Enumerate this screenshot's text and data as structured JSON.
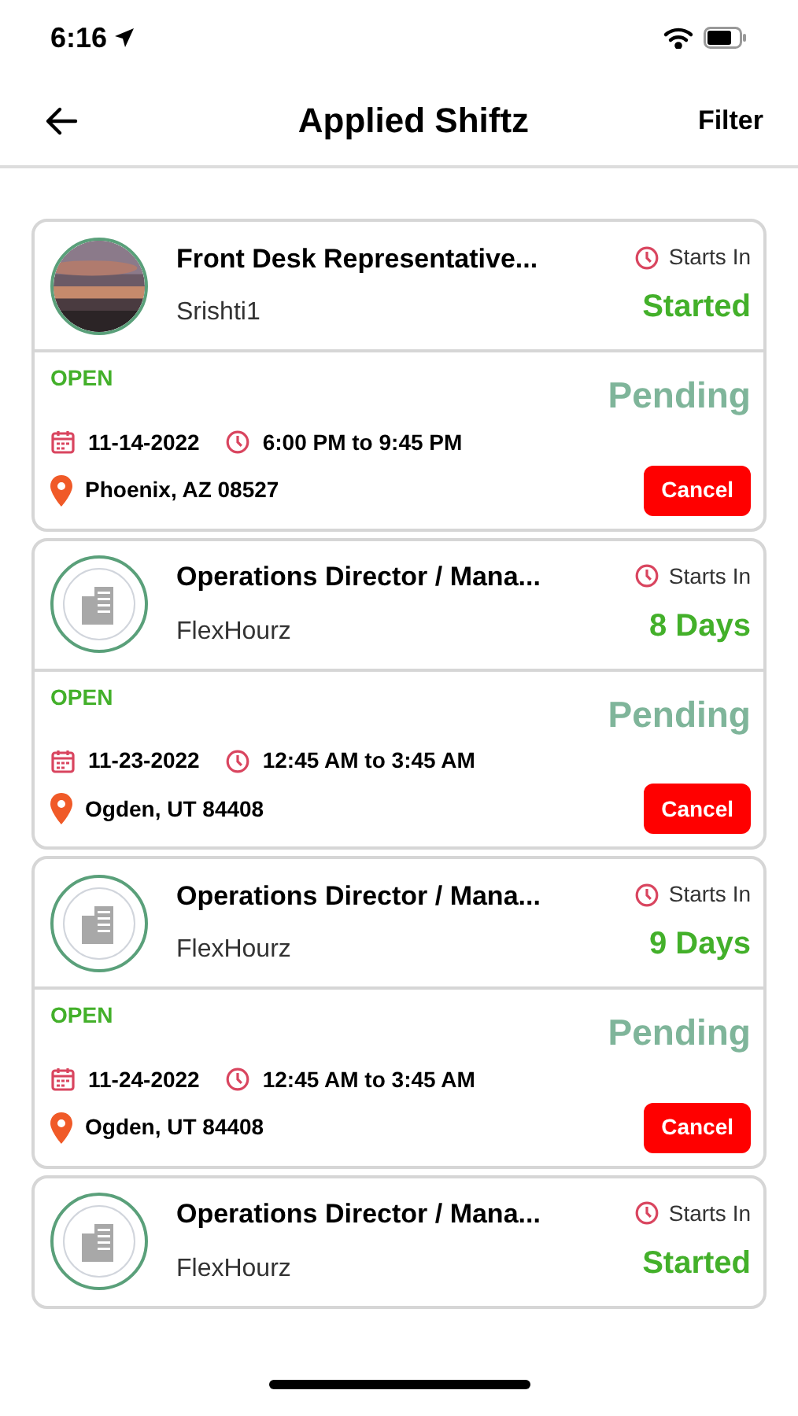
{
  "status_bar": {
    "time": "6:16"
  },
  "nav": {
    "title": "Applied Shiftz",
    "action": "Filter"
  },
  "shifts": [
    {
      "title": "Front Desk Representative...",
      "company": "Srishti1",
      "starts_label": "Starts In",
      "starts_value": "Started",
      "status": "OPEN",
      "approval": "Pending",
      "date": "11-14-2022",
      "time": "6:00 PM to 9:45 PM",
      "location": "Phoenix, AZ 08527",
      "button": "Cancel"
    },
    {
      "avatar": {
        "kind": "building"
      },
      "title": "Operations Director / Mana...",
      "company": "FlexHourz",
      "starts_label": "Starts In",
      "starts_value": "8 Days",
      "status": "OPEN",
      "approval": "Pending",
      "date": "11-23-2022",
      "time": "12:45 AM to 3:45 AM",
      "location": "Ogden, UT 84408",
      "button": "Cancel"
    },
    {
      "avatar": {
        "kind": "building"
      },
      "title": "Operations Director / Mana...",
      "company": "FlexHourz",
      "starts_label": "Starts In",
      "starts_value": "9 Days",
      "status": "OPEN",
      "approval": "Pending",
      "date": "11-24-2022",
      "time": "12:45 AM to 3:45 AM",
      "location": "Ogden, UT 84408",
      "button": "Cancel"
    },
    {
      "avatar": {
        "kind": "building"
      },
      "title": "Operations Director / Mana...",
      "company": "FlexHourz",
      "starts_label": "Starts In",
      "starts_value": "Started"
    }
  ]
}
